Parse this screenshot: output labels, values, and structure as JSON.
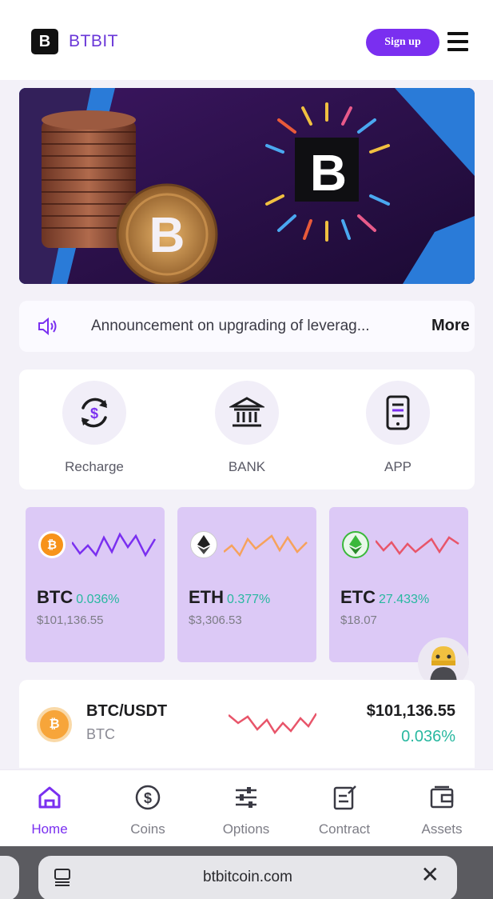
{
  "header": {
    "brand": "BTBIT",
    "logo_letter": "B",
    "signup_label": "Sign up"
  },
  "announcement": {
    "text": "Announcement on upgrading of leverag...",
    "more_label": "More"
  },
  "quick_actions": [
    {
      "label": "Recharge",
      "icon": "recharge-icon"
    },
    {
      "label": "BANK",
      "icon": "bank-icon"
    },
    {
      "label": "APP",
      "icon": "app-icon"
    }
  ],
  "coins": [
    {
      "symbol": "BTC",
      "change": "0.036%",
      "price": "$101,136.55",
      "icon": "bitcoin-icon",
      "color": "#f7931a",
      "spark_color": "#7a2ff0"
    },
    {
      "symbol": "ETH",
      "change": "0.377%",
      "price": "$3,306.53",
      "icon": "ethereum-icon",
      "color": "#ffffff",
      "spark_color": "#f6a25c"
    },
    {
      "symbol": "ETC",
      "change": "27.433%",
      "price": "$18.07",
      "icon": "ethereum-classic-icon",
      "color": "#3ab83a",
      "spark_color": "#e8556a"
    }
  ],
  "pair": {
    "name": "BTC/USDT",
    "base": "BTC",
    "price": "$101,136.55",
    "change": "0.036%",
    "icon": "bitcoin-icon",
    "spark_color": "#e8556a"
  },
  "tabs": [
    {
      "label": "Home",
      "icon": "home-icon",
      "active": true
    },
    {
      "label": "Coins",
      "icon": "coins-icon",
      "active": false
    },
    {
      "label": "Options",
      "icon": "options-icon",
      "active": false
    },
    {
      "label": "Contract",
      "icon": "contract-icon",
      "active": false
    },
    {
      "label": "Assets",
      "icon": "wallet-icon",
      "active": false
    }
  ],
  "browser": {
    "url": "btbitcoin.com"
  },
  "colors": {
    "accent": "#7a2ff0",
    "positive": "#28b8a0",
    "card_bg": "#dcc9f6"
  }
}
